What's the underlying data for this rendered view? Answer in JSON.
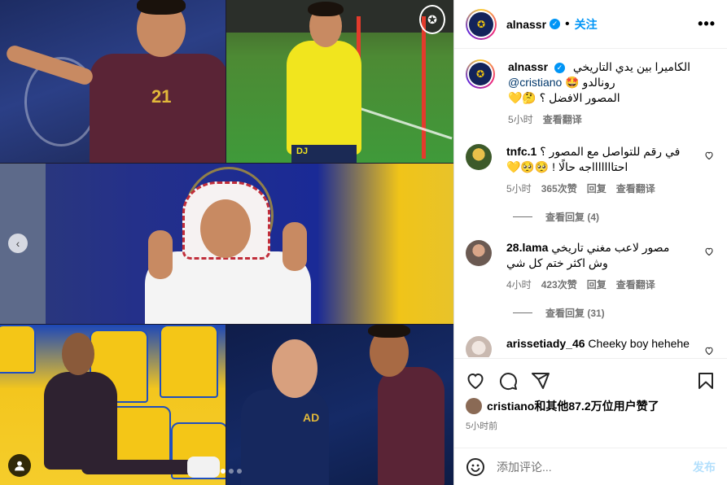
{
  "media": {
    "jersey_numbers": [
      "21",
      "DJ",
      "AD"
    ],
    "logo_text": "✪",
    "prev_icon": "‹",
    "carousel": {
      "count": 3,
      "active": 0
    }
  },
  "header": {
    "username": "alnassr",
    "separator": "•",
    "follow_label": "关注",
    "more_label": "•••"
  },
  "caption": {
    "username": "alnassr",
    "line1": "الكاميرا بين يدي التاريخي",
    "mention": "@cristiano",
    "line2_rest": "رونالدو 🤩",
    "line3": "المصور الافضل ؟ 🤔💛",
    "time": "5小时",
    "translate": "查看翻译"
  },
  "comments": [
    {
      "username": "tnfc.1",
      "text1": "في رقم للتواصل مع المصور ؟",
      "text2": "احتاااااااجه حالًا ! 🥺🥺💛",
      "time": "5小时",
      "likes": "365次赞",
      "reply": "回复",
      "translate": "查看翻译",
      "view_replies": "查看回复 (4)"
    },
    {
      "username": "28.lama",
      "text1": "مصور لاعب مغني تاريخي",
      "text2": "وش اكثر ختم كل شي",
      "time": "4小时",
      "likes": "423次赞",
      "reply": "回复",
      "translate": "查看翻译",
      "view_replies": "查看回复 (31)"
    },
    {
      "username": "arissetiady_46",
      "text1": "Cheeky boy hehehe"
    }
  ],
  "footer": {
    "liked_by": "cristiano和其他87.2万位用户赞了",
    "time": "5小时前",
    "placeholder": "添加评论...",
    "post_label": "发布"
  },
  "colors": {
    "accent": "#0095f6",
    "muted": "#737373",
    "post_disabled": "#b2dffc"
  }
}
